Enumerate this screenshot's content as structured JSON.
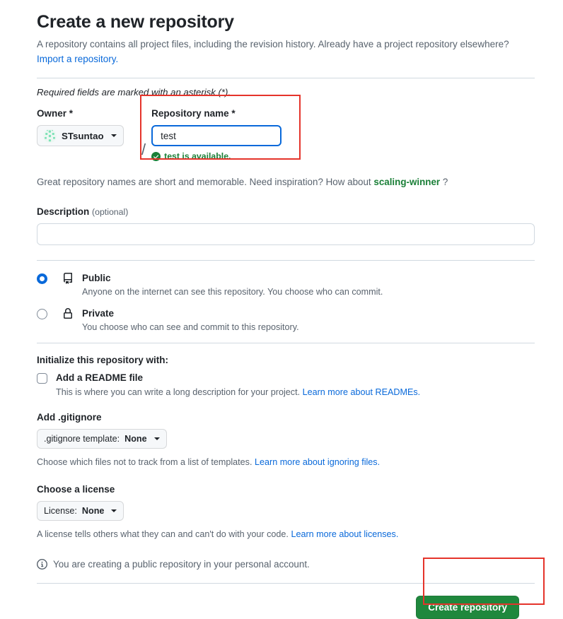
{
  "header": {
    "title": "Create a new repository",
    "subtitle": "A repository contains all project files, including the revision history. Already have a project repository elsewhere?",
    "import_link": "Import a repository.",
    "required_note": "Required fields are marked with an asterisk (*)."
  },
  "owner": {
    "label": "Owner *",
    "name": "STsuntao",
    "separator": "/"
  },
  "repo_name": {
    "label": "Repository name *",
    "value": "test",
    "placeholder": "",
    "availability": "test is available."
  },
  "inspiration": {
    "prefix": "Great repository names are short and memorable. Need inspiration? How about",
    "suggestion": "scaling-winner",
    "suffix": "?"
  },
  "description": {
    "label": "Description",
    "optional": "(optional)",
    "value": "",
    "placeholder": ""
  },
  "visibility": [
    {
      "id": "public",
      "icon": "repo-icon",
      "title": "Public",
      "desc": "Anyone on the internet can see this repository. You choose who can commit.",
      "selected": true
    },
    {
      "id": "private",
      "icon": "lock-icon",
      "title": "Private",
      "desc": "You choose who can see and commit to this repository.",
      "selected": false
    }
  ],
  "initialize": {
    "heading": "Initialize this repository with:",
    "readme": {
      "title": "Add a README file",
      "desc": "This is where you can write a long description for your project.",
      "link": "Learn more about READMEs.",
      "checked": false
    }
  },
  "gitignore": {
    "heading": "Add .gitignore",
    "select_prefix": ".gitignore template:",
    "select_value": "None",
    "helper": "Choose which files not to track from a list of templates.",
    "helper_link": "Learn more about ignoring files."
  },
  "license": {
    "heading": "Choose a license",
    "select_prefix": "License:",
    "select_value": "None",
    "helper": "A license tells others what they can and can't do with your code.",
    "helper_link": "Learn more about licenses."
  },
  "footer": {
    "notice": "You are creating a public repository in your personal account.",
    "create_label": "Create repository"
  },
  "colors": {
    "accent_blue": "#0969da",
    "success_green": "#1a7f37",
    "button_green": "#1f883d",
    "annotation_red": "#e5342b",
    "muted_text": "#59636e",
    "border": "#d1d9e0"
  }
}
